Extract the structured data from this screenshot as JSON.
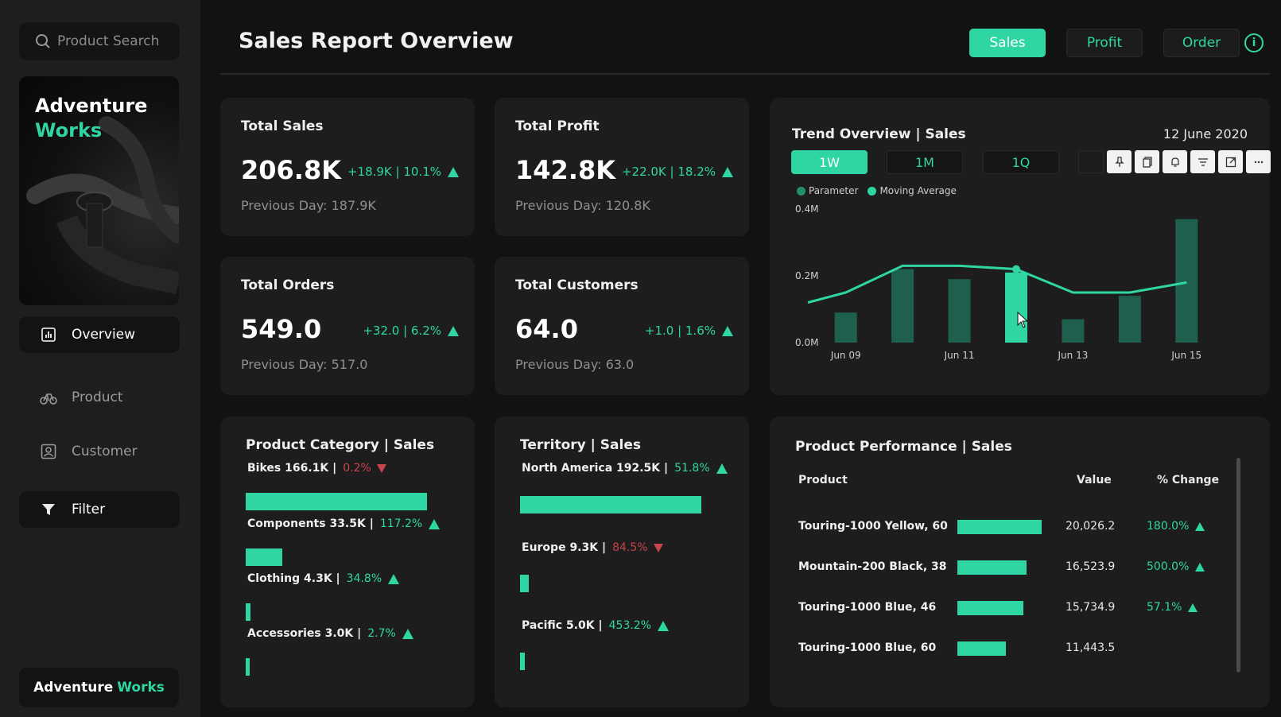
{
  "search": {
    "placeholder": "Product Search"
  },
  "hero": {
    "word1": "Adventure",
    "word2": "Works"
  },
  "sidebar": {
    "items": [
      {
        "label": "Overview",
        "icon": "bar-chart-icon",
        "active": true
      },
      {
        "label": "Product",
        "icon": "bicycle-icon",
        "active": false
      },
      {
        "label": "Customer",
        "icon": "person-icon",
        "active": false
      },
      {
        "label": "Filter",
        "icon": "funnel-icon",
        "active": true
      }
    ],
    "brand_word1": "Adventure",
    "brand_word2": "Works"
  },
  "header": {
    "title": "Sales Report Overview",
    "tabs": [
      {
        "label": "Sales",
        "active": true
      },
      {
        "label": "Profit",
        "active": false
      },
      {
        "label": "Order",
        "active": false
      }
    ],
    "info_label": "i"
  },
  "kpis": {
    "sales": {
      "title": "Total Sales",
      "value": "206.8K",
      "delta": "+18.9K | 10.1%",
      "prev": "Previous Day: 187.9K"
    },
    "profit": {
      "title": "Total Profit",
      "value": "142.8K",
      "delta": "+22.0K | 18.2%",
      "prev": "Previous Day: 120.8K"
    },
    "orders": {
      "title": "Total Orders",
      "value": "549.0",
      "delta": "+32.0 | 6.2%",
      "prev": "Previous Day: 517.0"
    },
    "customers": {
      "title": "Total Customers",
      "value": "64.0",
      "delta": "+1.0 | 1.6%",
      "prev": "Previous Day: 63.0"
    }
  },
  "trend": {
    "title": "Trend Overview | Sales",
    "date": "12 June 2020",
    "ranges": [
      {
        "label": "1W",
        "active": true
      },
      {
        "label": "1M",
        "active": false
      },
      {
        "label": "1Q",
        "active": false
      }
    ],
    "tools": [
      "pin-icon",
      "copy-icon",
      "bell-icon",
      "filter-icon",
      "expand-icon",
      "more-icon"
    ],
    "legend": [
      {
        "label": "Parameter",
        "color": "#1f8f6e"
      },
      {
        "label": "Moving Average",
        "color": "#2fd6a3"
      }
    ]
  },
  "chart_data": {
    "type": "bar",
    "title": "Trend Overview | Sales",
    "categories": [
      "Jun 09",
      "Jun 10",
      "Jun 11",
      "Jun 12",
      "Jun 13",
      "Jun 14",
      "Jun 15"
    ],
    "x_tick_labels": [
      "Jun 09",
      "Jun 11",
      "Jun 13",
      "Jun 15"
    ],
    "y_tick_labels": [
      "0.0M",
      "0.2M",
      "0.4M"
    ],
    "ylim": [
      0,
      0.4
    ],
    "series": [
      {
        "name": "Parameter",
        "type": "bar",
        "values": [
          0.09,
          0.22,
          0.19,
          0.21,
          0.07,
          0.14,
          0.37
        ],
        "highlight_index": 3
      },
      {
        "name": "Moving Average",
        "type": "line",
        "values": [
          0.15,
          0.23,
          0.23,
          0.22,
          0.15,
          0.15,
          0.18
        ]
      }
    ],
    "grid": false,
    "legend_position": "top-left",
    "colors": {
      "bar": "#1f5f4d",
      "bar_highlight": "#2fd6a3",
      "line": "#2fd6a3"
    }
  },
  "category": {
    "title": "Product Category | Sales",
    "max": 166.1,
    "rows": [
      {
        "label": "Bikes 166.1K |",
        "pct": "0.2%",
        "dir": "down",
        "value": 166.1
      },
      {
        "label": "Components 33.5K |",
        "pct": "117.2%",
        "dir": "up",
        "value": 33.5
      },
      {
        "label": "Clothing 4.3K |",
        "pct": "34.8%",
        "dir": "up",
        "value": 4.3
      },
      {
        "label": "Accessories 3.0K |",
        "pct": "2.7%",
        "dir": "up",
        "value": 3.0
      }
    ]
  },
  "territory": {
    "title": "Territory | Sales",
    "max": 192.5,
    "rows": [
      {
        "label": "North America 192.5K |",
        "pct": "51.8%",
        "dir": "up",
        "value": 192.5
      },
      {
        "label": "Europe 9.3K |",
        "pct": "84.5%",
        "dir": "down",
        "value": 9.3
      },
      {
        "label": "Pacific 5.0K |",
        "pct": "453.2%",
        "dir": "up",
        "value": 5.0
      }
    ]
  },
  "performance": {
    "title": "Product Performance | Sales",
    "headers": {
      "product": "Product",
      "value": "Value",
      "change": "% Change"
    },
    "max": 20026.2,
    "rows": [
      {
        "name": "Touring-1000 Yellow, 60",
        "value_text": "20,026.2",
        "value": 20026.2,
        "change": "180.0%"
      },
      {
        "name": "Mountain-200 Black, 38",
        "value_text": "16,523.9",
        "value": 16523.9,
        "change": "500.0%"
      },
      {
        "name": "Touring-1000 Blue, 46",
        "value_text": "15,734.9",
        "value": 15734.9,
        "change": "57.1%"
      },
      {
        "name": "Touring-1000 Blue, 60",
        "value_text": "11,443.5",
        "value": 11443.5,
        "change": ""
      }
    ]
  }
}
